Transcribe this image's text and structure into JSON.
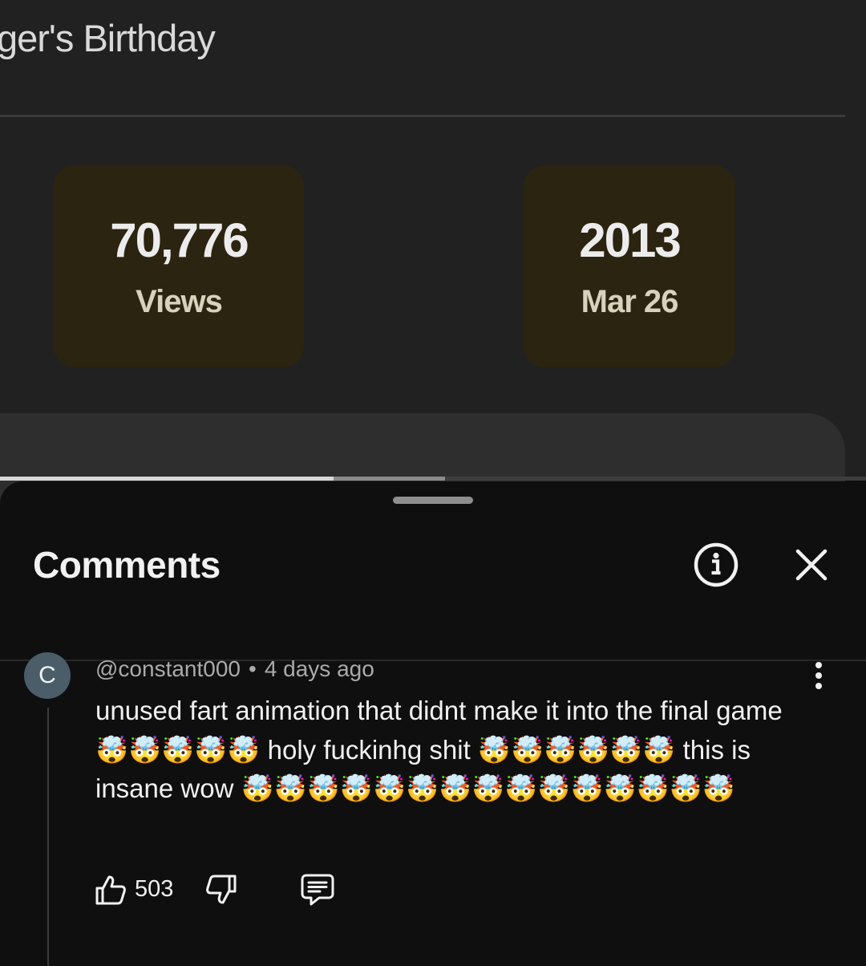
{
  "video": {
    "title_fragment": "ger's Birthday",
    "stats": {
      "views_value": "70,776",
      "views_label": "Views",
      "year_value": "2013",
      "date_label": "Mar 26"
    },
    "progress": {
      "played_fraction": 0.385,
      "buffered_fraction": 0.514
    }
  },
  "comments_panel": {
    "title": "Comments",
    "info_icon": "info-circle-icon",
    "close_icon": "close-icon"
  },
  "comment": {
    "avatar_letter": "C",
    "author": "@constant000",
    "separator": "•",
    "time": "4 days ago",
    "text": "unused fart animation that didnt make it into the final game 🤯🤯🤯🤯🤯 holy fuckinhg shit 🤯🤯🤯🤯🤯🤯 this is insane wow 🤯🤯🤯🤯🤯🤯🤯🤯🤯🤯🤯🤯🤯🤯🤯",
    "like_count": "503",
    "like_icon": "thumbs-up-icon",
    "dislike_icon": "thumbs-down-icon",
    "reply_icon": "reply-icon",
    "more_icon": "more-vertical-icon"
  },
  "colors": {
    "background": "#0f0f0f",
    "stat_card": "#2b2410",
    "text_primary": "#f1f1f1",
    "text_secondary": "#aaaaaa",
    "avatar": "#4a5d68"
  }
}
